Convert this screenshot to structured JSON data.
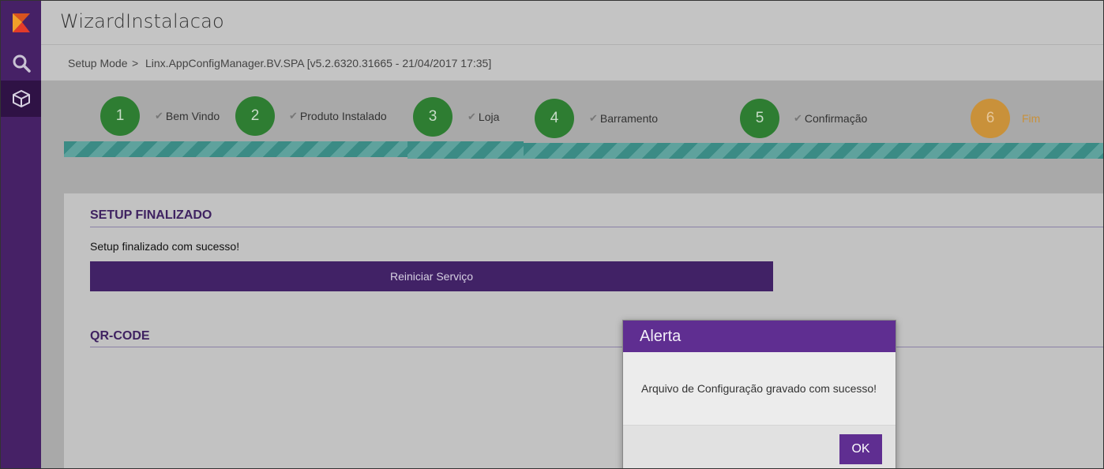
{
  "app": {
    "title": "WizardInstalacao"
  },
  "sidebar": {
    "items": [
      {
        "icon": "linx-logo-icon"
      },
      {
        "icon": "search-icon"
      },
      {
        "icon": "cube-icon",
        "active": true
      }
    ]
  },
  "breadcrumb": {
    "root": "Setup Mode",
    "separator": ">",
    "current": "Linx.AppConfigManager.BV.SPA [v5.2.6320.31665 - 21/04/2017 17:35]"
  },
  "wizard": {
    "steps": [
      {
        "number": "1",
        "label": "Bem Vindo",
        "done": true
      },
      {
        "number": "2",
        "label": "Produto Instalado",
        "done": true
      },
      {
        "number": "3",
        "label": "Loja",
        "done": true
      },
      {
        "number": "4",
        "label": "Barramento",
        "done": true
      },
      {
        "number": "5",
        "label": "Confirmação",
        "done": true
      },
      {
        "number": "6",
        "label": "Fim",
        "done": false,
        "current": true
      }
    ],
    "colors": {
      "done": "#2e7d32",
      "current": "#c9913a",
      "stripe": "#3b8b85"
    }
  },
  "panel": {
    "setup_title": "SETUP FINALIZADO",
    "setup_message": "Setup finalizado com sucesso!",
    "restart_button": "Reiniciar Serviço",
    "qr_title": "QR-CODE"
  },
  "dialog": {
    "title": "Alerta",
    "message": "Arquivo de Configuração gravado com sucesso!",
    "ok_label": "OK"
  },
  "colors": {
    "accent": "#5f2e91",
    "sidebar": "#462166"
  }
}
